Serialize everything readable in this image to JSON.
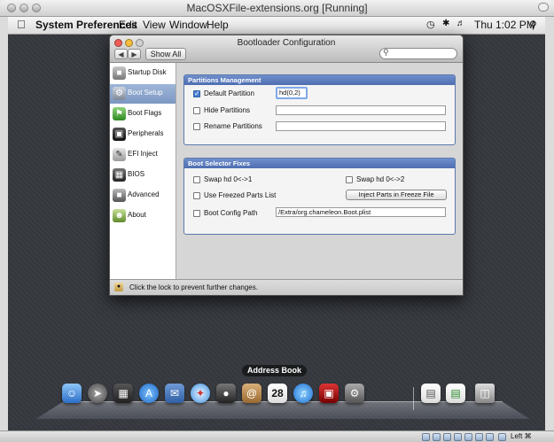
{
  "host": {
    "title": "MacOSXFile-extensions.org [Running]",
    "host_key": "Left ⌘"
  },
  "menubar": {
    "app": "System Preferences",
    "items": [
      "Edit",
      "View",
      "Window",
      "Help"
    ],
    "clock": "Thu 1:02 PM"
  },
  "window": {
    "title": "Bootloader Configuration",
    "show_all": "Show All",
    "search_placeholder": ""
  },
  "sidebar": {
    "items": [
      {
        "label": "Startup Disk",
        "icon": "drive-icon",
        "selected": false
      },
      {
        "label": "Boot Setup",
        "icon": "gears-icon",
        "selected": true
      },
      {
        "label": "Boot Flags",
        "icon": "flag-icon",
        "selected": false
      },
      {
        "label": "Peripherals",
        "icon": "display-icon",
        "selected": false
      },
      {
        "label": "EFI Inject",
        "icon": "pen-icon",
        "selected": false
      },
      {
        "label": "BIOS",
        "icon": "chip-icon",
        "selected": false
      },
      {
        "label": "Advanced",
        "icon": "drive-icon",
        "selected": false
      },
      {
        "label": "About",
        "icon": "user-icon",
        "selected": false
      }
    ]
  },
  "partitions": {
    "header": "Partitions Management",
    "default_partition": {
      "label": "Default Partition",
      "checked": true,
      "value": "hd(0,2)"
    },
    "hide_partitions": {
      "label": "Hide Partitions",
      "checked": false,
      "value": ""
    },
    "rename_partitions": {
      "label": "Rename Partitions",
      "checked": false,
      "value": ""
    }
  },
  "selector": {
    "header": "Boot Selector Fixes",
    "swap1": {
      "label": "Swap hd  0<->1",
      "checked": false
    },
    "swap2": {
      "label": "Swap hd  0<->2",
      "checked": false
    },
    "freezed": {
      "label": "Use Freezed Parts List",
      "checked": false
    },
    "inject_button": "Inject Parts in Freeze File",
    "boot_config": {
      "label": "Boot Config Path",
      "checked": false,
      "value": "/Extra/org.chameleon.Boot.plist"
    }
  },
  "lockbar": {
    "text": "Click the lock to prevent further changes."
  },
  "dock": {
    "tooltip": "Address Book",
    "calendar_day": "28"
  },
  "colors": {
    "selection": "#7c97c2",
    "group_header": "#4d6db0",
    "desktop": "#3a3d43"
  }
}
